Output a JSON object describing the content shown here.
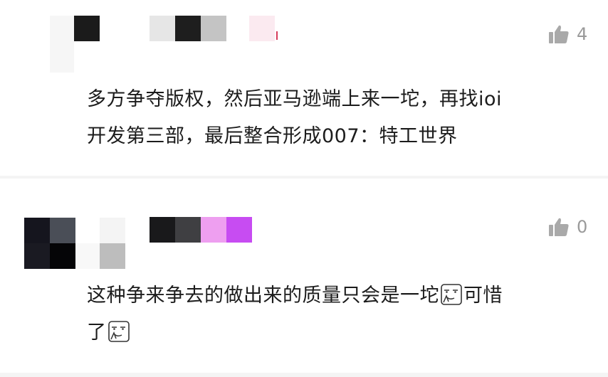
{
  "comments": [
    {
      "text_lines": [
        "多方争夺版权，然后亚马逊端上来一坨，再找ioi",
        "开发第三部，最后整合形成007：特工世界"
      ],
      "likes": "4",
      "icon": "thumbs-up-icon"
    },
    {
      "text_line1": "这种争来争去的做出来的质量只会是一坨",
      "text_tail1": "可惜",
      "text_line2": "了",
      "likes": "0",
      "icon": "thumbs-up-icon",
      "emoji": "doge-face-emoji"
    }
  ],
  "colors": {
    "like_gray": "#9a9a9a",
    "text": "#1c1c1c",
    "divider": "#f4f4f4"
  }
}
